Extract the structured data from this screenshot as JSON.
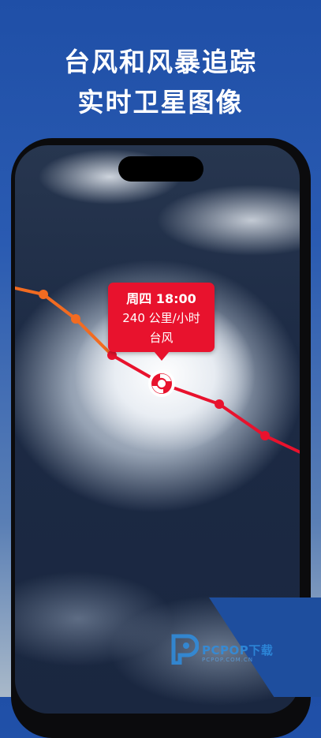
{
  "headline": {
    "line1": "台风和风暴追踪",
    "line2": "实时卫星图像"
  },
  "storm_popup": {
    "time": "周四 18:00",
    "speed": "240 公里/小时",
    "category": "台风"
  },
  "colors": {
    "track_past": "#f26b21",
    "track_forecast": "#e8122d",
    "popup_bg": "#e8122d"
  },
  "icons": [
    "typhoon-icon",
    "track-point-icon"
  ],
  "watermark": {
    "brand": "PCPOP下载",
    "sub": "PCPOP.COM.CN"
  }
}
